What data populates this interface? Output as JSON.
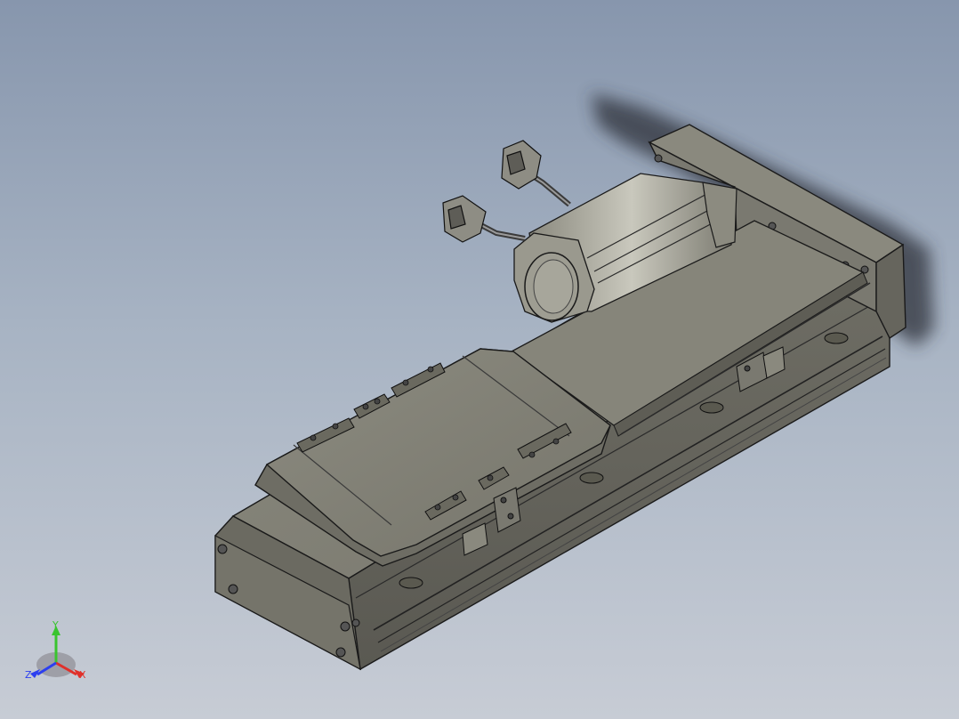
{
  "triad": {
    "x_label": "X",
    "y_label": "Y",
    "z_label": "Z",
    "x_color": "#e0302a",
    "y_color": "#39c42f",
    "z_color": "#2c3ff0"
  },
  "colors": {
    "body": "#7e7d72",
    "body_dark": "#5e5d55",
    "body_light": "#9a998d",
    "edge": "#1a1a1a",
    "shadow": "#3a3e45"
  }
}
